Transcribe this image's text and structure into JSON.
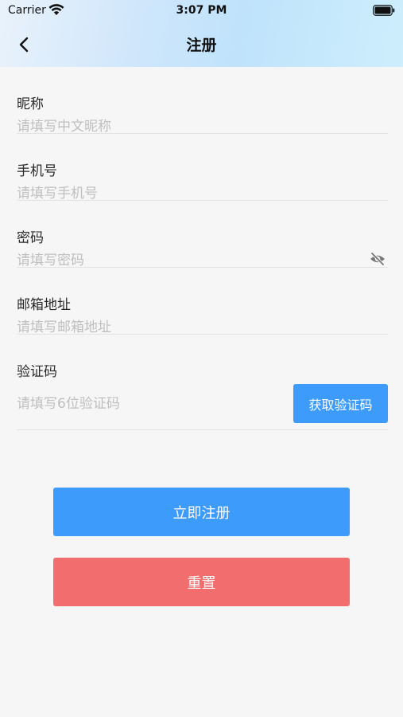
{
  "status_bar": {
    "carrier": "Carrier",
    "time": "3:07 PM",
    "wifi_icon": "wifi-icon",
    "battery_icon": "battery-icon"
  },
  "nav": {
    "title": "注册",
    "back_icon": "chevron-left-icon"
  },
  "form": {
    "fields": [
      {
        "label": "昵称",
        "placeholder": "请填写中文昵称",
        "value": ""
      },
      {
        "label": "手机号",
        "placeholder": "请填写手机号",
        "value": ""
      },
      {
        "label": "密码",
        "placeholder": "请填写密码",
        "value": "",
        "toggle_icon": "eye-off-icon"
      },
      {
        "label": "邮箱地址",
        "placeholder": "请填写邮箱地址",
        "value": ""
      },
      {
        "label": "验证码",
        "placeholder": "请填写6位验证码",
        "value": "",
        "button_label": "获取验证码"
      }
    ]
  },
  "actions": {
    "register_label": "立即注册",
    "reset_label": "重置"
  },
  "colors": {
    "primary": "#3d9bfb",
    "danger": "#f26d6d",
    "background": "#f6f6f6"
  }
}
